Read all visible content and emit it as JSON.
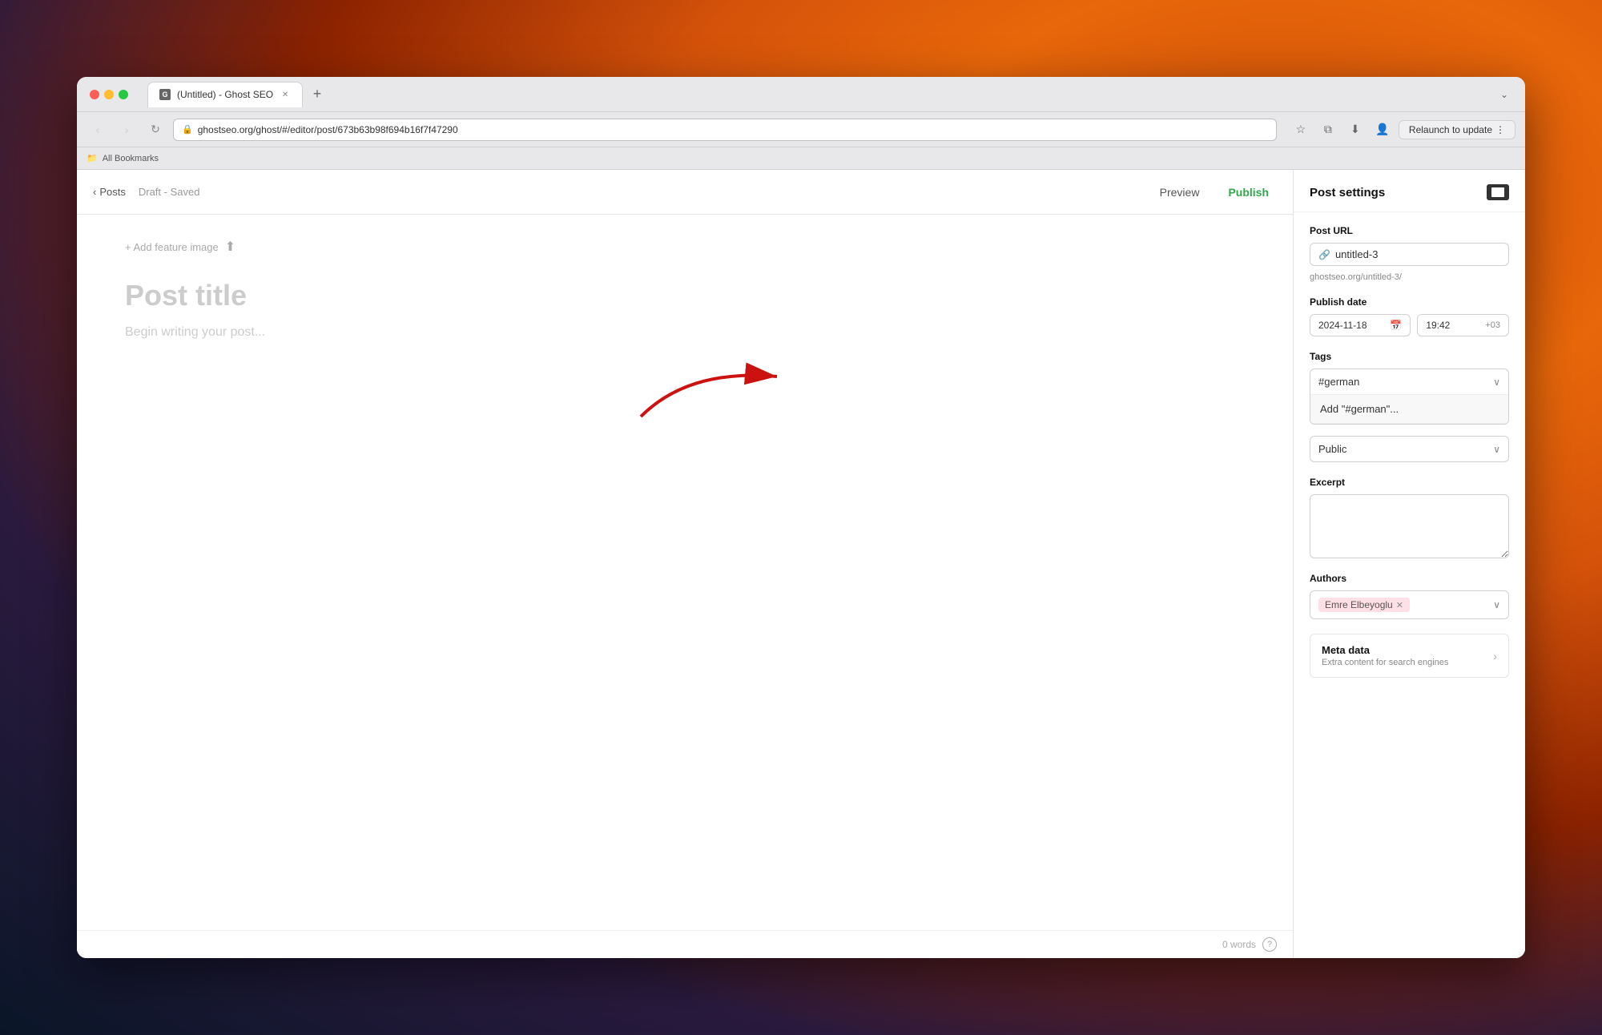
{
  "desktop": {
    "background": "gradient"
  },
  "browser": {
    "tab_title": "(Untitled) - Ghost SEO",
    "tab_favicon": "G",
    "address": "ghostseo.org/ghost/#/editor/post/673b63b98f694b16f7f47290",
    "relaunch_label": "Relaunch to update",
    "bookmarks_label": "All Bookmarks"
  },
  "editor": {
    "back_label": "Posts",
    "draft_status": "Draft - Saved",
    "preview_label": "Preview",
    "publish_label": "Publish",
    "add_feature_image_label": "+ Add feature image",
    "post_title_placeholder": "Post title",
    "post_body_placeholder": "Begin writing your post...",
    "word_count": "0 words"
  },
  "settings": {
    "title": "Post settings",
    "post_url_label": "Post URL",
    "post_url_value": "untitled-3",
    "post_url_hint": "ghostseo.org/untitled-3/",
    "publish_date_label": "Publish date",
    "publish_date_value": "2024-11-18",
    "publish_time_value": "19:42",
    "timezone_offset": "+03",
    "tags_label": "Tags",
    "tag_value": "#german",
    "tag_suggestion": "Add \"#german\"...",
    "access_value": "Public",
    "excerpt_label": "Excerpt",
    "excerpt_placeholder": "",
    "authors_label": "Authors",
    "author_name": "Emre Elbeyoglu",
    "meta_data_label": "Meta data",
    "meta_data_hint": "Extra content for search engines"
  }
}
